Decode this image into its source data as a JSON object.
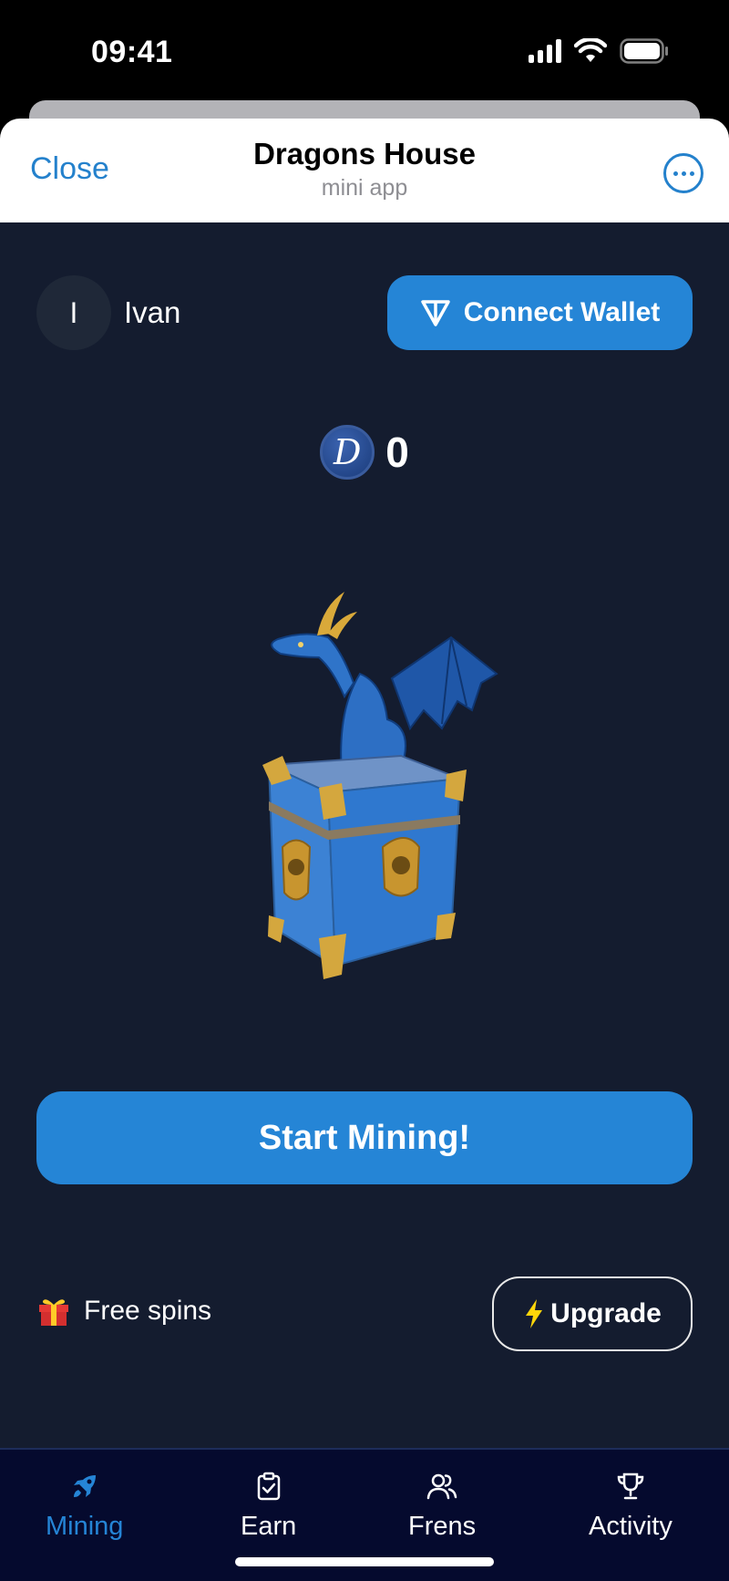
{
  "status_bar": {
    "time": "09:41"
  },
  "header": {
    "close_label": "Close",
    "title": "Dragons House",
    "subtitle": "mini app"
  },
  "user": {
    "initial": "I",
    "name": "Ivan"
  },
  "wallet": {
    "label": "Connect Wallet",
    "icon": "ton-icon"
  },
  "balance": {
    "value": "0",
    "coin_letter": "D"
  },
  "mining": {
    "label": "Start Mining!"
  },
  "free_spins": {
    "label": "Free spins",
    "icon": "gift-icon"
  },
  "upgrade": {
    "label": "Upgrade",
    "icon": "lightning-icon"
  },
  "nav": {
    "items": [
      {
        "label": "Mining",
        "icon": "rocket-icon",
        "active": true
      },
      {
        "label": "Earn",
        "icon": "clipboard-check-icon",
        "active": false
      },
      {
        "label": "Frens",
        "icon": "users-icon",
        "active": false
      },
      {
        "label": "Activity",
        "icon": "trophy-icon",
        "active": false
      }
    ]
  },
  "colors": {
    "background": "#141c2f",
    "accent": "#2585d6",
    "nav_background": "#050a2e",
    "header_link": "#2481cc"
  }
}
